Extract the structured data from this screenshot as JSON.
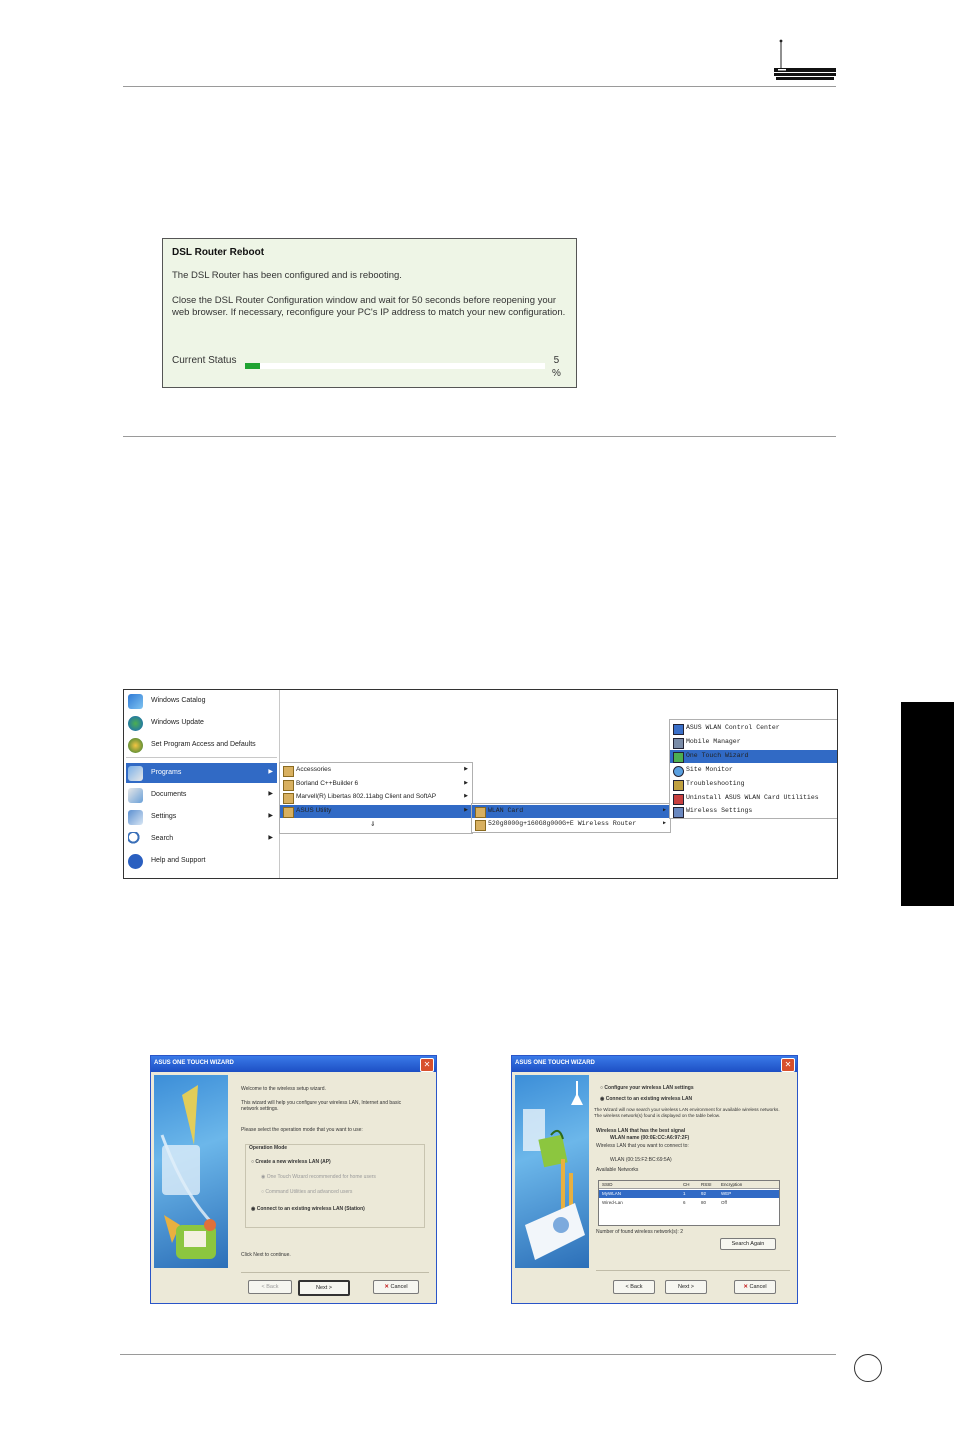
{
  "dsl_panel": {
    "title": "DSL Router Reboot",
    "line1": "The DSL Router has been configured and is rebooting.",
    "line2": "Close the DSL Router Configuration window and wait for 50 seconds before reopening your web browser. If necessary, reconfigure your PC's IP address to match your new configuration.",
    "status_label": "Current Status",
    "progress_percent": 5,
    "progress_value": "5",
    "progress_unit": "%",
    "progress_color": "#1fa331"
  },
  "start_menu": {
    "left_items": [
      {
        "label": "Windows Catalog"
      },
      {
        "label": "Windows Update"
      },
      {
        "label": "Set Program Access and Defaults"
      },
      {
        "label": "Programs"
      },
      {
        "label": "Documents"
      },
      {
        "label": "Settings"
      },
      {
        "label": "Search"
      },
      {
        "label": "Help and Support"
      }
    ],
    "programs_items": [
      {
        "label": "Accessories"
      },
      {
        "label": "Borland C++Builder 6"
      },
      {
        "label": "Marvell(R) Libertas 802.11abg Client and SoftAP"
      },
      {
        "label": "ASUS Utility"
      },
      {
        "label": "⇓"
      }
    ],
    "asus_items": [
      {
        "label": "WLAN Card"
      },
      {
        "label": "520g8000g+160G8g000G+E Wireless Router"
      }
    ],
    "wlan_items": [
      {
        "label": "ASUS WLAN Control Center"
      },
      {
        "label": "Mobile Manager"
      },
      {
        "label": "One Touch Wizard"
      },
      {
        "label": "Site Monitor"
      },
      {
        "label": "Troubleshooting"
      },
      {
        "label": "Uninstall ASUS WLAN Card Utilities"
      },
      {
        "label": "Wireless Settings"
      }
    ]
  },
  "wizard1": {
    "title": "ASUS ONE TOUCH WIZARD",
    "intro": "Welcome to the wireless setup wizard.",
    "desc": "This wizard will help you configure your wireless LAN, Internet and basic network settings.",
    "select": "Please select the operation mode that you want to use:",
    "group_label": "Operation Mode",
    "opt1": "Create a new wireless LAN (AP)",
    "opt1a": "One Touch Wizard recommended for home users",
    "opt1b": "Command Utilities and advanced users",
    "opt2": "Connect to an existing wireless LAN (Station)",
    "hint": "Click Next to continue.",
    "back": "< Back",
    "next": "Next >",
    "cancel": "Cancel"
  },
  "wizard2": {
    "title": "ASUS ONE TOUCH WIZARD",
    "opt1": "Configure your wireless LAN settings",
    "opt2": "Connect to an existing wireless LAN",
    "desc": "The Wizard will now search your wireless LAN environment for available wireless networks. The wireless network(s) found is displayed on the table below.",
    "signal": "Wireless LAN that has the best signal",
    "mac": "WLAN name (00:0E:CC:A6:97:2F)",
    "choose": "Wireless LAN that you want to connect to:",
    "ssid_value": "WLAN (00:15:F2:BC:69:5A)",
    "avail": "Available Networks",
    "col_ssid": "SSID",
    "col_ch": "CH",
    "col_rssi": "RSSI",
    "col_enc": "Encryption",
    "rows": [
      {
        "ssid": "MyWLAN",
        "ch": "1",
        "rssi": "92",
        "enc": "WEP"
      },
      {
        "ssid": "Wired-Lan",
        "ch": "6",
        "rssi": "80",
        "enc": "Off"
      }
    ],
    "count": "Number of found wireless network(s): 2",
    "search": "Search Again",
    "back": "< Back",
    "next": "Next >",
    "cancel": "Cancel"
  }
}
